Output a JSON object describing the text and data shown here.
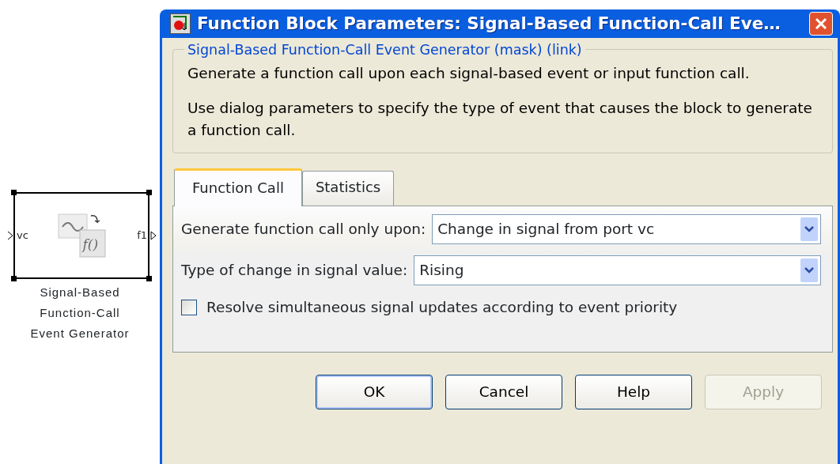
{
  "block": {
    "input_port": "vc",
    "output_port": "f1",
    "icon_text": "f()",
    "label_lines": [
      "Signal-Based",
      "Function-Call",
      "Event Generator"
    ],
    "selected": true
  },
  "window": {
    "title": "Function Block Parameters: Signal-Based Function-Call Eve…"
  },
  "group": {
    "legend": "Signal-Based Function-Call Event Generator (mask) (link)",
    "paragraphs": [
      "Generate a function call upon each signal-based event or input function call.",
      "Use dialog parameters to specify the type of event that causes the block to generate a function call."
    ]
  },
  "tabs": [
    {
      "label": "Function Call",
      "selected": true
    },
    {
      "label": "Statistics",
      "selected": false
    }
  ],
  "fields": [
    {
      "kind": "dropdown",
      "label": "Generate function call only upon:",
      "value": "Change in signal from port vc"
    },
    {
      "kind": "dropdown",
      "label": "Type of change in signal value:",
      "value": "Rising"
    },
    {
      "kind": "checkbox",
      "label": "Resolve simultaneous signal updates according to event priority",
      "checked": false
    }
  ],
  "buttons": [
    {
      "label": "OK",
      "default": true,
      "disabled": false
    },
    {
      "label": "Cancel",
      "default": false,
      "disabled": false
    },
    {
      "label": "Help",
      "default": false,
      "disabled": false
    },
    {
      "label": "Apply",
      "default": false,
      "disabled": true
    }
  ]
}
